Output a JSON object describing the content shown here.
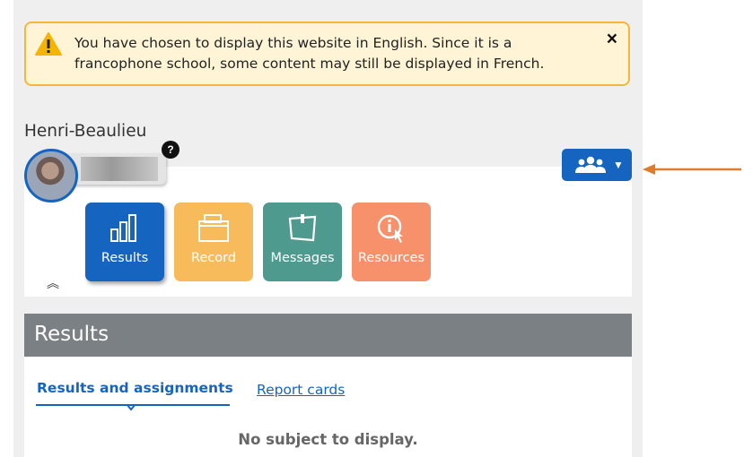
{
  "notice": {
    "text": "You have chosen to display this website in English. Since it is a francophone school, some content may still be displayed in French.",
    "close_label": "×",
    "icon": "warning-icon"
  },
  "school": {
    "name": "Henri-Beaulieu"
  },
  "profile": {
    "help_label": "?",
    "avatar_icon": "avatar"
  },
  "group_selector": {
    "icon": "users-group-icon",
    "caret": "▼"
  },
  "collapse": {
    "label": "︽"
  },
  "tiles": [
    {
      "label": "Results",
      "icon": "bar-chart-icon",
      "color": "#1565c0"
    },
    {
      "label": "Record",
      "icon": "folder-icon",
      "color": "#f8bb5c"
    },
    {
      "label": "Messages",
      "icon": "message-board-icon",
      "color": "#4e9a8e"
    },
    {
      "label": "Resources",
      "icon": "info-pointer-icon",
      "color": "#f7916c"
    }
  ],
  "results": {
    "title": "Results",
    "tabs": [
      {
        "label": "Results and assignments",
        "active": true
      },
      {
        "label": "Report cards",
        "active": false
      }
    ],
    "empty_message": "No subject to display."
  },
  "colors": {
    "accent": "#1565c0",
    "warning_border": "#f4b73c",
    "warning_bg": "#fff4d6",
    "section_header": "#7b8084",
    "annotation_arrow": "#e07b2a"
  }
}
